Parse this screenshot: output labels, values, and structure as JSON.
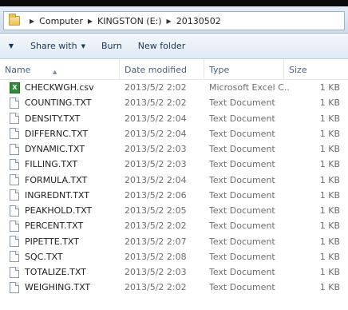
{
  "address": {
    "crumbs": [
      "Computer",
      "KINGSTON (E:)",
      "20130502"
    ]
  },
  "toolbar": {
    "share_label": "Share with",
    "burn_label": "Burn",
    "new_folder_label": "New folder"
  },
  "columns": {
    "name": "Name",
    "date": "Date modified",
    "type": "Type",
    "size": "Size"
  },
  "files": [
    {
      "name": "CHECKWGH.csv",
      "date": "2013/5/2 2:02",
      "type": "Microsoft Excel C...",
      "size": "1 KB",
      "icon": "excel-csv-icon"
    },
    {
      "name": "COUNTING.TXT",
      "date": "2013/5/2 2:02",
      "type": "Text Document",
      "size": "1 KB",
      "icon": "text-file-icon"
    },
    {
      "name": "DENSITY.TXT",
      "date": "2013/5/2 2:04",
      "type": "Text Document",
      "size": "1 KB",
      "icon": "text-file-icon"
    },
    {
      "name": "DIFFERNC.TXT",
      "date": "2013/5/2 2:04",
      "type": "Text Document",
      "size": "1 KB",
      "icon": "text-file-icon"
    },
    {
      "name": "DYNAMIC.TXT",
      "date": "2013/5/2 2:03",
      "type": "Text Document",
      "size": "1 KB",
      "icon": "text-file-icon"
    },
    {
      "name": "FILLING.TXT",
      "date": "2013/5/2 2:03",
      "type": "Text Document",
      "size": "1 KB",
      "icon": "text-file-icon"
    },
    {
      "name": "FORMULA.TXT",
      "date": "2013/5/2 2:04",
      "type": "Text Document",
      "size": "1 KB",
      "icon": "text-file-icon"
    },
    {
      "name": "INGREDNT.TXT",
      "date": "2013/5/2 2:06",
      "type": "Text Document",
      "size": "1 KB",
      "icon": "text-file-icon"
    },
    {
      "name": "PEAKHOLD.TXT",
      "date": "2013/5/2 2:05",
      "type": "Text Document",
      "size": "1 KB",
      "icon": "text-file-icon"
    },
    {
      "name": "PERCENT.TXT",
      "date": "2013/5/2 2:02",
      "type": "Text Document",
      "size": "1 KB",
      "icon": "text-file-icon"
    },
    {
      "name": "PIPETTE.TXT",
      "date": "2013/5/2 2:07",
      "type": "Text Document",
      "size": "1 KB",
      "icon": "text-file-icon"
    },
    {
      "name": "SQC.TXT",
      "date": "2013/5/2 2:08",
      "type": "Text Document",
      "size": "1 KB",
      "icon": "text-file-icon"
    },
    {
      "name": "TOTALIZE.TXT",
      "date": "2013/5/2 2:03",
      "type": "Text Document",
      "size": "1 KB",
      "icon": "text-file-icon"
    },
    {
      "name": "WEIGHING.TXT",
      "date": "2013/5/2 2:02",
      "type": "Text Document",
      "size": "1 KB",
      "icon": "text-file-icon"
    }
  ]
}
